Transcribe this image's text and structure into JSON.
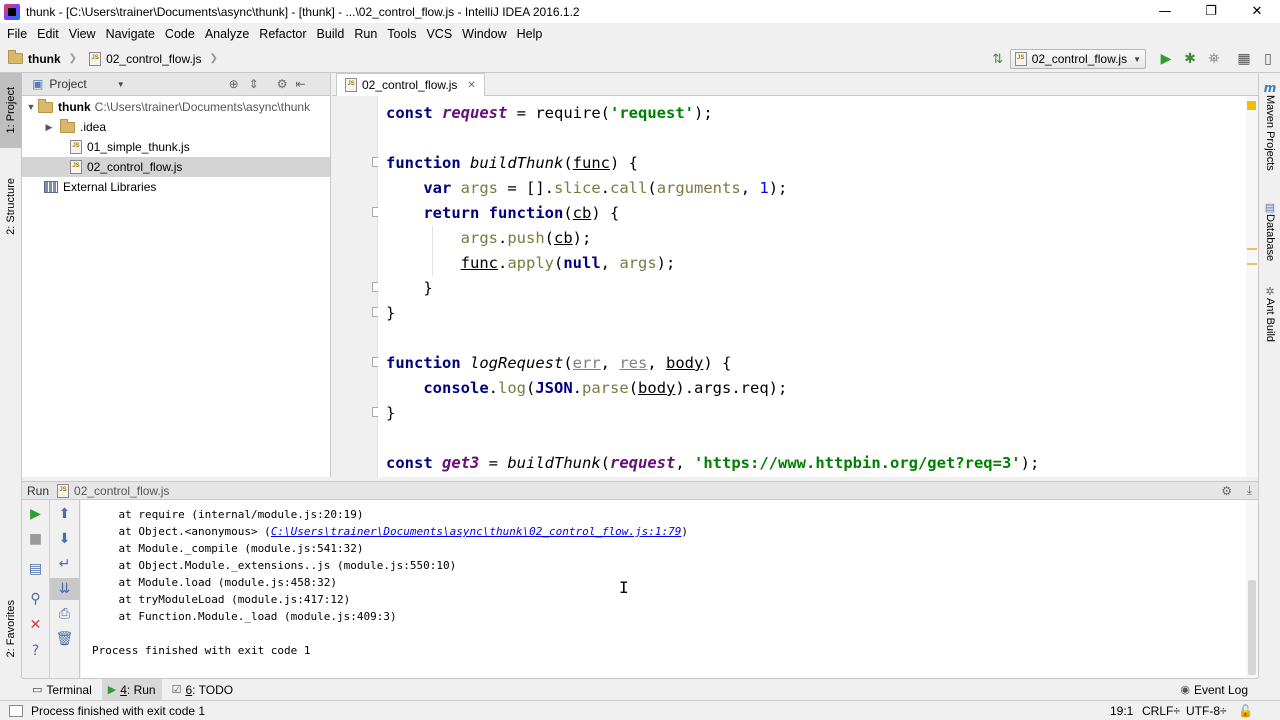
{
  "window": {
    "title": "thunk - [C:\\Users\\trainer\\Documents\\async\\thunk] - [thunk] - ...\\02_control_flow.js - IntelliJ IDEA 2016.1.2",
    "minimize": "—",
    "maximize": "❐",
    "close": "✕"
  },
  "menu": [
    "File",
    "Edit",
    "View",
    "Navigate",
    "Code",
    "Analyze",
    "Refactor",
    "Build",
    "Run",
    "Tools",
    "VCS",
    "Window",
    "Help"
  ],
  "breadcrumb": {
    "project": "thunk",
    "file": "02_control_flow.js"
  },
  "run_config": {
    "selected": "02_control_flow.js"
  },
  "left_strip": {
    "project_tab": "1: Project",
    "structure_tab": "2: Structure",
    "favorites_tab": "2: Favorites"
  },
  "right_strip": {
    "maven": "Maven Projects",
    "database": "Database",
    "ant": "Ant Build"
  },
  "project_panel": {
    "header": "Project",
    "root": {
      "name": "thunk",
      "path": "C:\\Users\\trainer\\Documents\\async\\thunk"
    },
    "items": [
      ".idea",
      "01_simple_thunk.js",
      "02_control_flow.js"
    ],
    "external": "External Libraries"
  },
  "editor": {
    "tab": "02_control_flow.js",
    "code": {
      "l1": {
        "kw": "const",
        "var": "request",
        "op": " = require(",
        "str": "'request'",
        "end": ");"
      },
      "l3": {
        "kw": "function",
        "name": "buildThunk",
        "open": "(",
        "param": "func",
        "close": ") {"
      },
      "l4": {
        "kw": "var",
        "var": "args",
        "op": " = [].",
        "m1": "slice",
        "dot": ".",
        "m2": "call",
        "open": "(",
        "arg": "arguments",
        "comma": ", ",
        "num": "1",
        "end": ");"
      },
      "l5": {
        "kw": "return",
        "kw2": "function",
        "open": "(",
        "param": "cb",
        "close": ") {"
      },
      "l6": {
        "var": "args",
        "dot": ".",
        "m": "push",
        "open": "(",
        "param": "cb",
        "end": ");"
      },
      "l7": {
        "param": "func",
        "dot": ".",
        "m": "apply",
        "open": "(",
        "kw": "null",
        "comma": ", ",
        "var": "args",
        "end": ");"
      },
      "l8": "}",
      "l9": "}",
      "l11": {
        "kw": "function",
        "name": "logRequest",
        "open": "(",
        "p1": "err",
        "c1": ", ",
        "p2": "res",
        "c2": ", ",
        "p3": "body",
        "close": ") {"
      },
      "l12": {
        "obj": "console",
        "dot": ".",
        "m": "log",
        "open": "(",
        "json": "JSON",
        "dot2": ".",
        "m2": "parse",
        "open2": "(",
        "param": "body",
        "rest": ").args.req);"
      },
      "l13": "}",
      "l15": {
        "kw": "const",
        "var": "get3",
        "op": " = ",
        "fn": "buildThunk",
        "open": "(",
        "arg": "request",
        "comma": ", ",
        "str": "'https://www.httpbin.org/get?req=3'",
        "end": ");"
      }
    }
  },
  "run_panel": {
    "label": "Run",
    "config": "02_control_flow.js",
    "lines": [
      "    at require (internal/module.js:20:19)",
      "    at Object.<anonymous> (",
      "    at Module._compile (module.js:541:32)",
      "    at Object.Module._extensions..js (module.js:550:10)",
      "    at Module.load (module.js:458:32)",
      "    at tryModuleLoad (module.js:417:12)",
      "    at Function.Module._load (module.js:409:3)",
      "",
      "Process finished with exit code 1"
    ],
    "link": "C:\\Users\\trainer\\Documents\\async\\thunk\\02_control_flow.js:1:79",
    "link_close": ")"
  },
  "bottom_tabs": [
    {
      "num": "",
      "label": "Terminal"
    },
    {
      "num": "4",
      "label": ": Run"
    },
    {
      "num": "6",
      "label": ": TODO"
    }
  ],
  "event_log": "Event Log",
  "status": {
    "message": "Process finished with exit code 1",
    "position": "19:1",
    "line_sep": "CRLF÷",
    "encoding": "UTF-8÷"
  },
  "colors": {
    "keyword": "#000080",
    "string": "#008000",
    "number": "#0000ff",
    "variable": "#660e7a"
  }
}
